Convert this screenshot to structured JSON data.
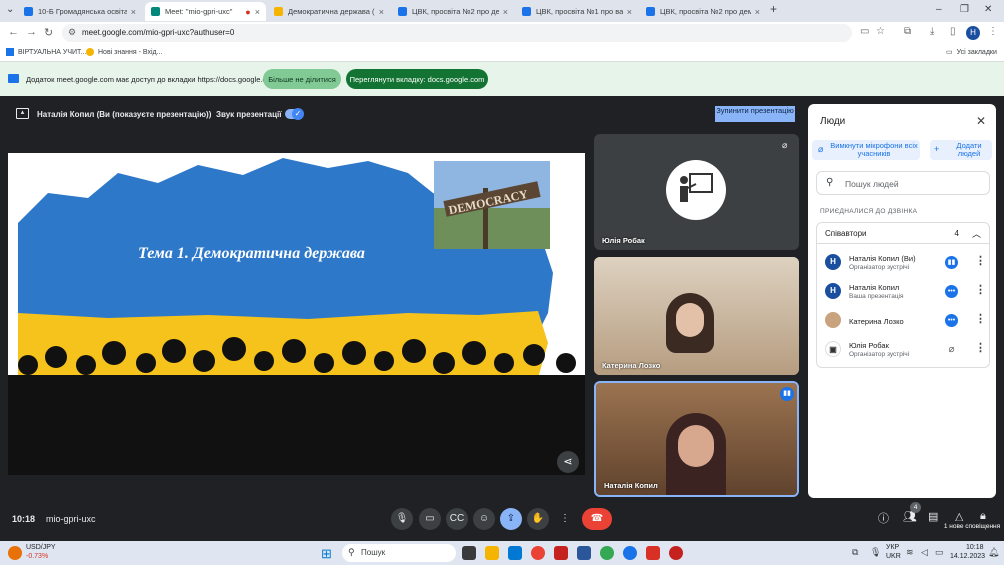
{
  "browser": {
    "tabs": [
      {
        "label": "10-Б Громадянська освіта Ко",
        "active": false,
        "favicon_color": "#1a73e8"
      },
      {
        "label": "Meet: \"mio-gpri-uxc\"",
        "active": true,
        "favicon_color": "#00897b"
      },
      {
        "label": "Демократична держава (к",
        "active": false,
        "favicon_color": "#f4b400"
      },
      {
        "label": "ЦВК, просвіта №2 про демок",
        "active": false,
        "favicon_color": "#1a73e8"
      },
      {
        "label": "ЦВК, просвіта №1 про важли",
        "active": false,
        "favicon_color": "#1a73e8"
      },
      {
        "label": "ЦВК, просвіта №2 про демок",
        "active": false,
        "favicon_color": "#1a73e8"
      }
    ],
    "url": "meet.google.com/mio-gpri-uxc?authuser=0",
    "profile_initial": "H",
    "bookmarks": [
      {
        "label": "ВІРТУАЛЬНА УЧИТ..."
      },
      {
        "label": "Нові знання - Вхід..."
      }
    ],
    "all_bookmarks_label": "Усі закладки"
  },
  "infobar": {
    "message": "Додаток meet.google.com має доступ до вкладки https://docs.google.com",
    "dont_share_label": "Більше не ділитися",
    "share_tab_label": "Переглянути вкладку: docs.google.com"
  },
  "presentation_bar": {
    "presenter": "Наталія Копил (Ви (показуєте презентацію))",
    "sound_label": "Звук презентації",
    "stop_label": "Зупинити презентацію"
  },
  "slide": {
    "title": "Тема 1. Демократична держава",
    "sign_text": "DEMOCRACY"
  },
  "tiles": [
    {
      "name": "Юлія Робак"
    },
    {
      "name": "Катерина Лозко"
    },
    {
      "name": "Наталія Копил"
    }
  ],
  "people_panel": {
    "title": "Люди",
    "mute_all_label": "Вимкнути мікрофони всіх учасників",
    "add_people_label": "Додати людей",
    "search_placeholder": "Пошук людей",
    "section_label": "ПРИЄДНАЛИСЯ ДО ДЗВІНКА",
    "group_label": "Співавтори",
    "group_count": "4",
    "participants": [
      {
        "name": "Наталія Копил (Ви)",
        "role": "Організатор зустрічі",
        "initial": "Н",
        "avatar_color": "#1a4fa0"
      },
      {
        "name": "Наталія Копил",
        "role": "Ваша презентація",
        "initial": "Н",
        "avatar_color": "#1a4fa0"
      },
      {
        "name": "Катерина Лозко",
        "role": "",
        "initial": "",
        "avatar_color": "#c9a27e"
      },
      {
        "name": "Юлія Робак",
        "role": "Організатор зустрічі",
        "initial": "",
        "avatar_color": "#ffffff"
      }
    ]
  },
  "meet_bar": {
    "time": "10:18",
    "meeting_code": "mio-gpri-uxc",
    "people_badge": "4",
    "new_message_label": "1 нове сповіщення"
  },
  "taskbar": {
    "ticker_name": "USD/JPY",
    "ticker_change": "-0.73%",
    "search_label": "Пошук",
    "lang_line1": "УКР",
    "lang_line2": "UKR",
    "clock_time": "10:18",
    "clock_date": "14.12.2023"
  }
}
